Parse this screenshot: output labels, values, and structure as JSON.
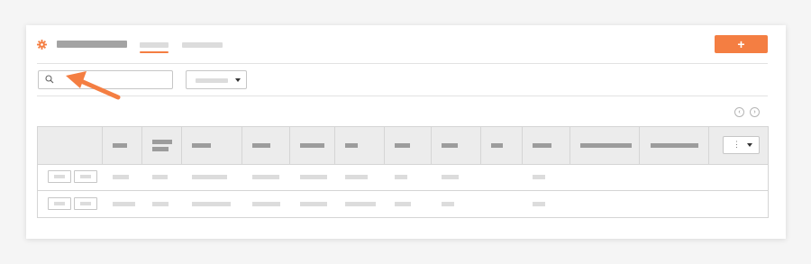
{
  "header": {
    "settings_icon": "gear-icon",
    "add_button_label": "+"
  },
  "search": {
    "icon": "search-icon",
    "value": "",
    "placeholder": ""
  },
  "filter": {
    "icon": "caret-down-icon"
  },
  "pager": {
    "prev_label": "‹",
    "next_label": "›"
  },
  "table": {
    "menu_icon": "vertical-dots-icon",
    "menu_label": "⋮",
    "row_count": 2
  },
  "colors": {
    "accent": "#f47e42",
    "header_bg": "#ececec",
    "placeholder": "#dcdcdc"
  },
  "annotation": {
    "icon": "pointer-arrow-icon",
    "color": "#f47e42"
  }
}
